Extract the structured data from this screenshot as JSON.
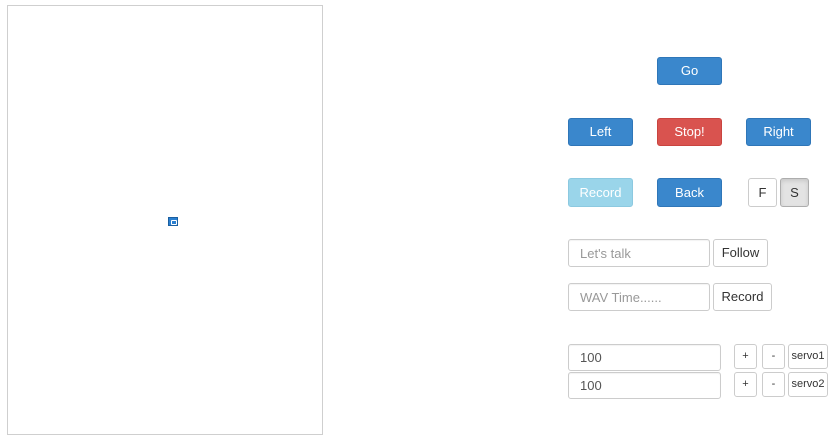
{
  "video": {
    "broken_image_icon": "broken-image-icon"
  },
  "controls": {
    "go": "Go",
    "left": "Left",
    "stop": "Stop!",
    "right": "Right",
    "record": "Record",
    "back": "Back",
    "fast": "F",
    "slow": "S"
  },
  "talk": {
    "placeholder": "Let's talk",
    "button": "Follow"
  },
  "wav": {
    "placeholder": "WAV Time......",
    "button": "Record"
  },
  "servos": [
    {
      "value": "100",
      "plus": "+",
      "minus": "-",
      "label": "servo1"
    },
    {
      "value": "100",
      "plus": "+",
      "minus": "-",
      "label": "servo2"
    }
  ],
  "colors": {
    "primary": "#3a87cc",
    "danger": "#d9534f",
    "info_disabled": "#9ad5ea",
    "default_border": "#cccccc"
  }
}
